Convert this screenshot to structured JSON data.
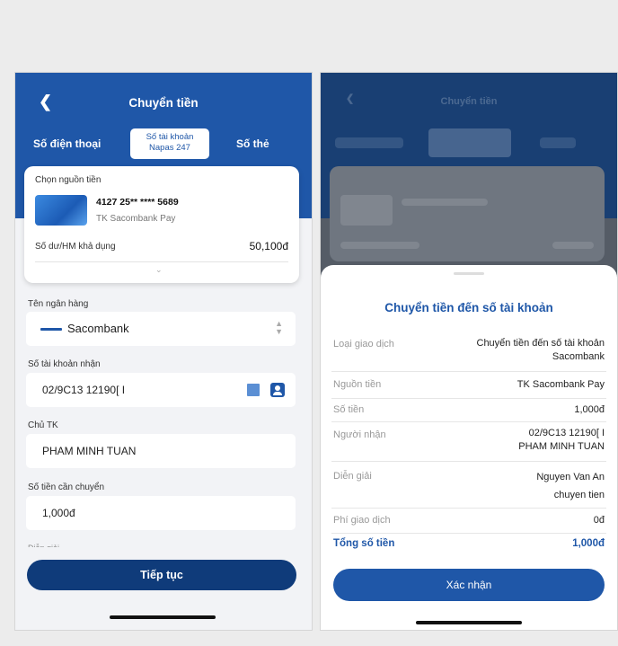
{
  "header": {
    "title": "Chuyển tiền",
    "tabs": [
      "Số điện thoại",
      "Số tài khoản",
      "Napas 247",
      "Số thẻ"
    ]
  },
  "source": {
    "label": "Chọn nguồn tiền",
    "card_number": "4127 25** **** 5689",
    "card_name": "TK Sacombank Pay",
    "balance_label": "Số dư/HM khả dụng",
    "balance_value": "50,100đ"
  },
  "form": {
    "bank_label": "Tên ngân hàng",
    "bank_value": "Sacombank",
    "account_label": "Số tài khoản nhận",
    "account_value": "02/9C13 12190[ I",
    "holder_label": "Chủ TK",
    "holder_value": "PHAM MINH TUAN",
    "amount_label": "Số tiền cần chuyển",
    "amount_value": "1,000đ",
    "next_label": "Diễn giải",
    "continue_button": "Tiếp tục"
  },
  "confirm": {
    "title": "Chuyển tiền đến số tài khoản",
    "rows": [
      {
        "label": "Loại giao dịch",
        "value_line1": "Chuyển tiền đến số tài khoản",
        "value_line2": "Sacombank"
      },
      {
        "label": "Nguồn tiền",
        "value_line1": "TK Sacombank Pay"
      },
      {
        "label": "Số tiền",
        "value_line1": "1,000đ"
      },
      {
        "label": "Người nhận",
        "value_line1": "02/9C13 12190[ I",
        "value_line2": "PHAM MINH TUAN"
      },
      {
        "label": "Diễn giải",
        "value_line1": "Nguyen Van An",
        "value_line2": "chuyen tien"
      },
      {
        "label": "Phí giao dịch",
        "value_line1": "0đ"
      }
    ],
    "total_label": "Tổng số tiền",
    "total_value": "1,000đ",
    "confirm_button": "Xác nhận"
  },
  "icons": {
    "back": "back-icon",
    "chevron": "chevron-down-icon",
    "sort": "sort-icon",
    "qr": "qr-icon",
    "contact": "contact-icon",
    "bank_logo": "sacombank-logo-icon"
  },
  "colors": {
    "primary": "#1f57a8",
    "button_dark": "#0f3b7a",
    "background": "#f2f3f6"
  }
}
